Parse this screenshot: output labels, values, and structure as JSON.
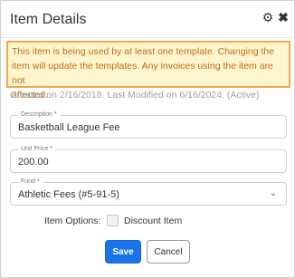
{
  "dialog": {
    "title": "Item Details",
    "icons": {
      "settings": "gear-icon",
      "close": "close-icon"
    }
  },
  "warning": {
    "lines": [
      "This item is being used by at least one template. Changing the",
      "item will update the templates. Any invoices using the item are not",
      "affected."
    ]
  },
  "meta": {
    "created": "Created on 2/16/2018. Last Modified on 6/16/2024. (Active)"
  },
  "form": {
    "description": {
      "label": "Description",
      "required_mark": "*",
      "value": "Basketball League Fee"
    },
    "unit_price": {
      "label": "Unit Price",
      "required_mark": "*",
      "value": "200.00"
    },
    "fund": {
      "label": "Fund",
      "required_mark": "*",
      "value": "Athletic Fees (#5-91-5)"
    },
    "item_options": {
      "label": "Item Options:",
      "discount_label": "Discount Item"
    }
  },
  "buttons": {
    "save": "Save",
    "cancel": "Cancel"
  },
  "colors": {
    "primary": "#1a73e8",
    "warning_bg": "#fff6cf",
    "warning_border": "#f0a84a",
    "warning_text": "#c06c13",
    "required": "#d93025"
  }
}
